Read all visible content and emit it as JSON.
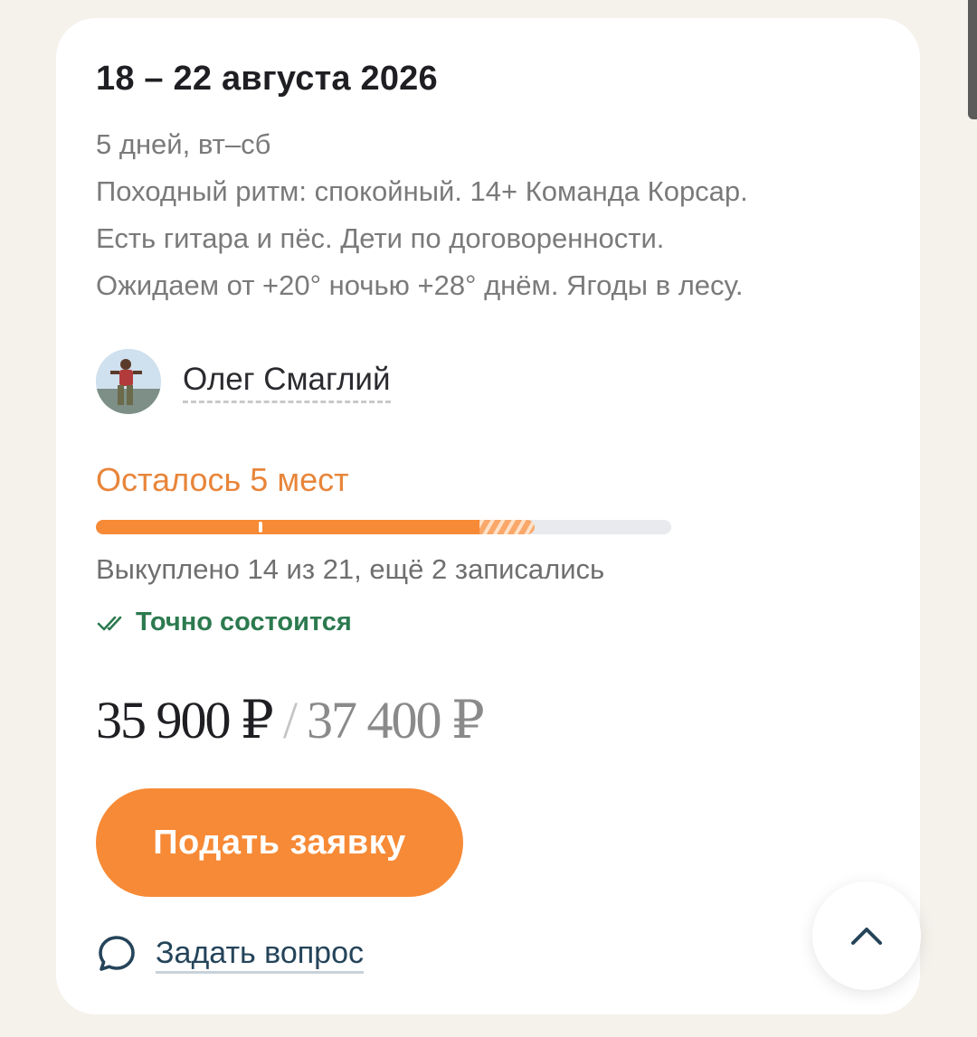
{
  "tour": {
    "dates": "18 – 22 августа 2026",
    "description_lines": [
      "5 дней, вт–сб",
      "Походный ритм: спокойный. 14+ Команда Корсар.",
      "Есть гитара и пёс. Дети по договоренности.",
      "Ожидаем от +20° ночью +28° днём. Ягоды в лесу."
    ],
    "guide_name": "Олег Смаглий",
    "seats_left": "Осталось 5 мест",
    "sold_text": "Выкуплено 14 из 21, ещё 2 записались",
    "progress": {
      "sold": 14,
      "pending": 2,
      "total": 21
    },
    "confirmed": "Точно состоится",
    "price": "35 900 ₽",
    "price_separator": "/",
    "old_price": "37 400 ₽",
    "apply_label": "Подать заявку",
    "ask_label": "Задать вопрос"
  },
  "icons": {
    "confirmed": "double-check-icon",
    "ask": "chat-bubble-icon",
    "scroll_top": "chevron-up-icon"
  },
  "colors": {
    "accent": "#f78a36",
    "confirmed": "#2c7a4f",
    "link": "#25445a"
  }
}
